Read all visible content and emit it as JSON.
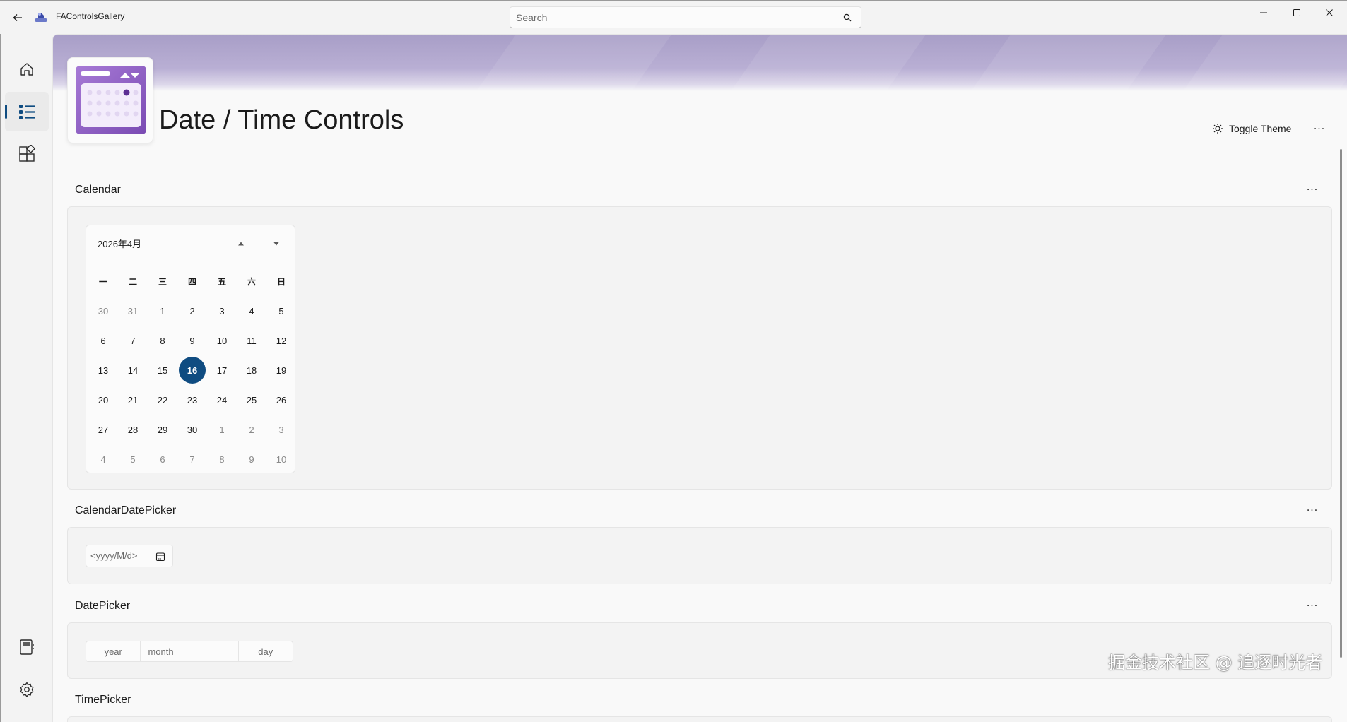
{
  "titlebar": {
    "app_name": "FAControlsGallery",
    "search_placeholder": "Search"
  },
  "header": {
    "title": "Date / Time Controls",
    "toggle_theme_label": "Toggle Theme",
    "more_label": "···"
  },
  "sections": {
    "calendar": {
      "title": "Calendar",
      "more": "···",
      "month_label": "2026年4月",
      "days_of_week": [
        "一",
        "二",
        "三",
        "四",
        "五",
        "六",
        "日"
      ],
      "weeks": [
        [
          "30",
          "31",
          "1",
          "2",
          "3",
          "4",
          "5"
        ],
        [
          "6",
          "7",
          "8",
          "9",
          "10",
          "11",
          "12"
        ],
        [
          "13",
          "14",
          "15",
          "16",
          "17",
          "18",
          "19"
        ],
        [
          "20",
          "21",
          "22",
          "23",
          "24",
          "25",
          "26"
        ],
        [
          "27",
          "28",
          "29",
          "30",
          "1",
          "2",
          "3"
        ],
        [
          "4",
          "5",
          "6",
          "7",
          "8",
          "9",
          "10"
        ]
      ],
      "today": "16"
    },
    "calendar_date_picker": {
      "title": "CalendarDatePicker",
      "more": "···",
      "placeholder": "<yyyy/M/d>"
    },
    "date_picker": {
      "title": "DatePicker",
      "more": "···",
      "year": "year",
      "month": "month",
      "day": "day"
    },
    "time_picker": {
      "title": "TimePicker"
    }
  },
  "watermark": "掘金技术社区 @ 追逐时光者",
  "colors": {
    "accent": "#0f4c81",
    "banner": "#b3a9d0",
    "icon_purple": "#8e5fc2"
  },
  "icons": {
    "nav": [
      "home-icon",
      "list-icon",
      "controls-icon",
      "book-icon",
      "gear-icon"
    ]
  }
}
